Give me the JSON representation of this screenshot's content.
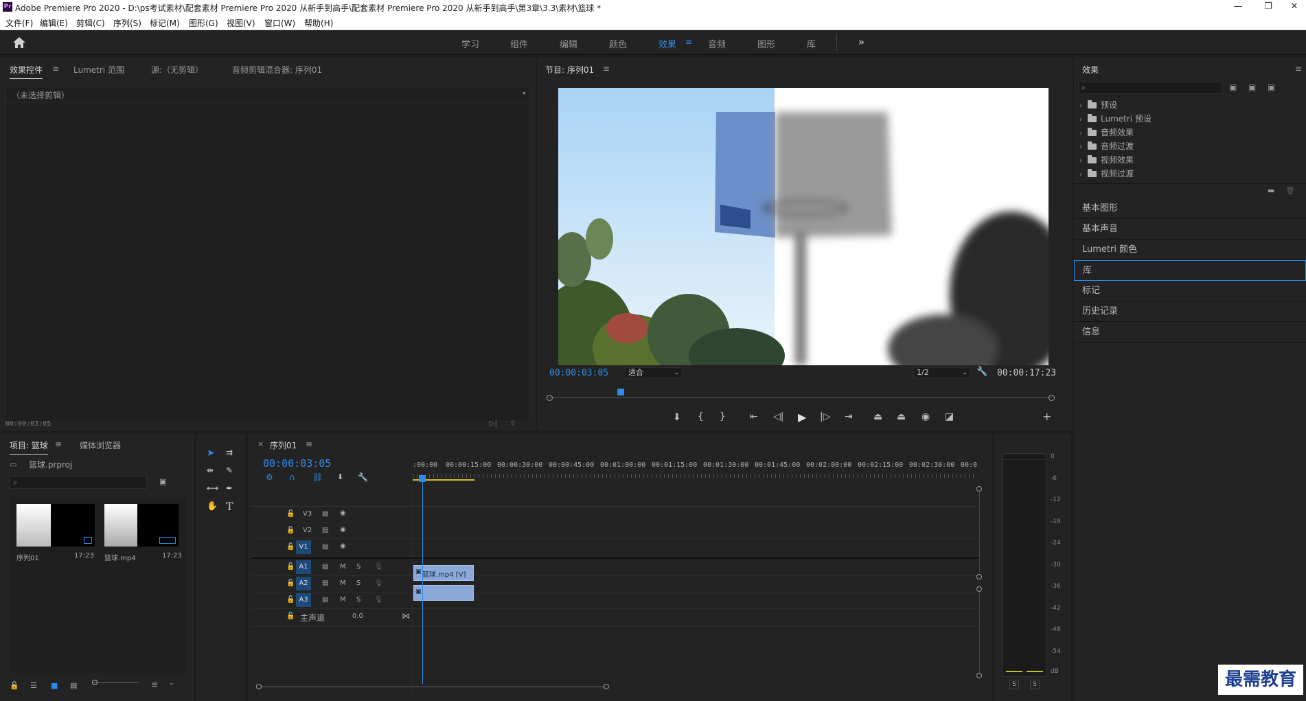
{
  "window": {
    "title": "Adobe Premiere Pro 2020 - D:\\ps考试素材\\配套素材 Premiere Pro 2020 从新手到高手\\配套素材 Premiere Pro 2020 从新手到高手\\第3章\\3.3\\素材\\篮球 *",
    "minimize": "—",
    "restore": "❐",
    "close": "✕"
  },
  "menu": [
    "文件(F)",
    "编辑(E)",
    "剪辑(C)",
    "序列(S)",
    "标记(M)",
    "图形(G)",
    "视图(V)",
    "窗口(W)",
    "帮助(H)"
  ],
  "workspaces": [
    "学习",
    "组件",
    "编辑",
    "颜色",
    "效果",
    "音频",
    "图形",
    "库"
  ],
  "workspace_active": "效果",
  "workspace_more": "»",
  "source_panel": {
    "tabs": [
      "效果控件",
      "Lumetri 范围",
      "源:（无剪辑）",
      "音频剪辑混合器: 序列01"
    ],
    "no_clip": "（未选择剪辑）",
    "timecode": "00:00:03:05"
  },
  "program_monitor": {
    "title": "节目: 序列01",
    "timecode": "00:00:03:05",
    "fit": "适合",
    "resolution": "1/2",
    "duration": "00:00:17:23"
  },
  "effects_panel": {
    "title": "效果",
    "tree": [
      "预设",
      "Lumetri 预设",
      "音频效果",
      "音频过渡",
      "视频效果",
      "视频过渡"
    ],
    "sections": [
      "基本图形",
      "基本声音",
      "Lumetri 颜色",
      "库",
      "标记",
      "历史记录",
      "信息"
    ],
    "selected_section": "库"
  },
  "project_panel": {
    "tabs": [
      "项目: 篮球",
      "媒体浏览器"
    ],
    "file": "篮球.prproj",
    "items": [
      {
        "name": "序列01",
        "duration": "17:23"
      },
      {
        "name": "篮球.mp4",
        "duration": "17:23"
      }
    ]
  },
  "timeline": {
    "title": "序列01",
    "close": "×",
    "timecode": "00:00:03:05",
    "ruler": [
      ":00:00",
      "00:00:15:00",
      "00:00:30:00",
      "00:00:45:00",
      "00:01:00:00",
      "00:01:15:00",
      "00:01:30:00",
      "00:01:45:00",
      "00:02:00:00",
      "00:02:15:00",
      "00:02:30:00",
      "00:0"
    ],
    "video_tracks": [
      "V3",
      "V2",
      "V1"
    ],
    "audio_tracks": [
      "A1",
      "A2",
      "A3"
    ],
    "master": "主声道",
    "master_value": "0.0",
    "clip_label": "篮球.mp4 [V]",
    "mute": "M",
    "solo": "S"
  },
  "audio_meter": {
    "scale": [
      "0",
      "-6",
      "-12",
      "-18",
      "-24",
      "-30",
      "-36",
      "-42",
      "-48",
      "-54",
      "dB"
    ],
    "solo_left": "S",
    "solo_right": "S"
  },
  "watermark": "最需教育",
  "colors": {
    "accent": "#2d8ceb",
    "clip": "#8aa9d8",
    "panel": "#232323"
  }
}
